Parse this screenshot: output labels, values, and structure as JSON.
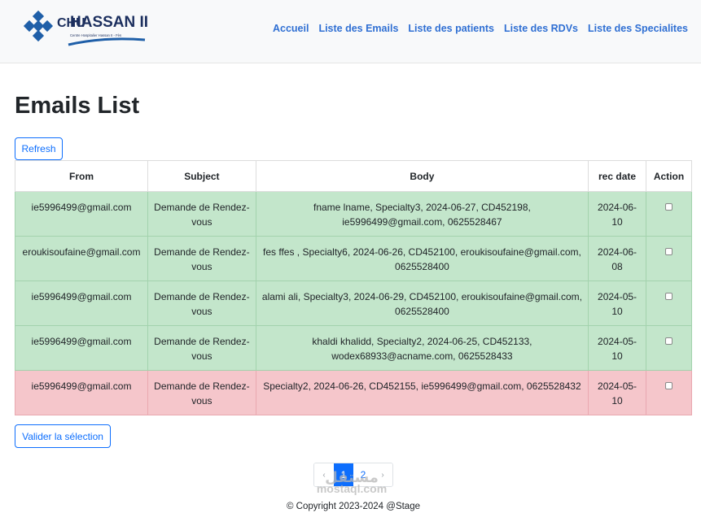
{
  "header": {
    "logo": {
      "text_top": "HASSAN II",
      "letters": "CHU",
      "caption": "Centre Hospitalier Hassan II - Fès",
      "color_blue": "#1f5fa8",
      "color_navy": "#1c2f5e"
    },
    "nav": [
      "Accueil",
      "Liste des Emails",
      "Liste des patients",
      "Liste des RDVs",
      "Liste des Specialites"
    ],
    "accent_color": "#2f6fd3"
  },
  "main": {
    "title": "Emails List",
    "refresh_label": "Refresh",
    "validate_label": "Valider la sélection",
    "table": {
      "headers": [
        "From",
        "Subject",
        "Body",
        "rec date",
        "Action"
      ],
      "rows": [
        {
          "from": "ie5996499@gmail.com",
          "subject": "Demande de Rendez-vous",
          "body": "fname lname, Specialty3, 2024-06-27, CD452198, ie5996499@gmail.com, 0625528467",
          "date": "2024-06-10",
          "status": "ok"
        },
        {
          "from": "eroukisoufaine@gmail.com",
          "subject": "Demande de Rendez-vous",
          "body": "fes ffes , Specialty6, 2024-06-26, CD452100, eroukisoufaine@gmail.com, 0625528400",
          "date": "2024-06-08",
          "status": "ok"
        },
        {
          "from": "ie5996499@gmail.com",
          "subject": "Demande de Rendez-vous",
          "body": "alami ali, Specialty3, 2024-06-29, CD452100, eroukisoufaine@gmail.com, 0625528400",
          "date": "2024-05-10",
          "status": "ok"
        },
        {
          "from": "ie5996499@gmail.com",
          "subject": "Demande de Rendez-vous",
          "body": "khaldi khalidd, Specialty2, 2024-06-25, CD452133, wodex68933@acname.com, 0625528433",
          "date": "2024-05-10",
          "status": "ok"
        },
        {
          "from": "ie5996499@gmail.com",
          "subject": "Demande de Rendez-vous",
          "body": "Specialty2, 2024-06-26, CD452155, ie5996499@gmail.com, 0625528432",
          "date": "2024-05-10",
          "status": "ko"
        }
      ],
      "colors": {
        "ok": "#c3e6cb",
        "ko": "#f5c6cb"
      }
    }
  },
  "pagination": {
    "prev": "‹",
    "pages": [
      "1",
      "2"
    ],
    "current": "1",
    "next": "›"
  },
  "watermark": {
    "line1": "مستقل",
    "line2": "mostaql.com"
  },
  "footer": {
    "copyright": "© Copyright 2023-2024 @Stage"
  }
}
